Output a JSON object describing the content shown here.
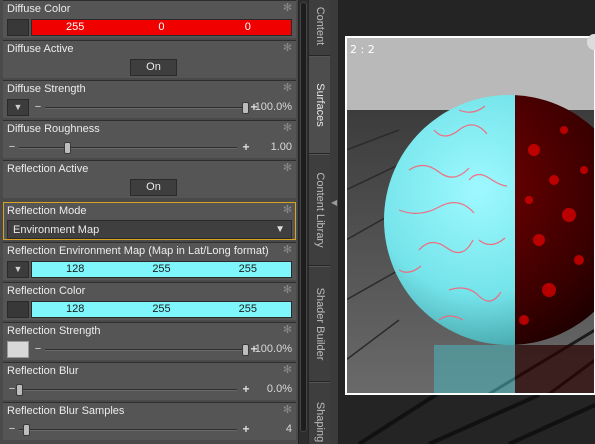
{
  "properties": {
    "diffuse_color": {
      "label": "Diffuse Color",
      "r": "255",
      "g": "0",
      "b": "0"
    },
    "diffuse_active": {
      "label": "Diffuse Active",
      "value": "On"
    },
    "diffuse_strength": {
      "label": "Diffuse Strength",
      "value": "100.0%",
      "level": 1.0
    },
    "diffuse_roughness": {
      "label": "Diffuse Roughness",
      "value": "1.00",
      "level": 0.22
    },
    "reflection_active": {
      "label": "Reflection Active",
      "value": "On"
    },
    "reflection_mode": {
      "label": "Reflection Mode",
      "value": "Environment Map"
    },
    "reflection_env_map": {
      "label": "Reflection Environment Map (Map in Lat/Long format)",
      "r": "128",
      "g": "255",
      "b": "255"
    },
    "reflection_color": {
      "label": "Reflection Color",
      "r": "128",
      "g": "255",
      "b": "255"
    },
    "reflection_strength": {
      "label": "Reflection Strength",
      "value": "100.0%",
      "level": 1.0
    },
    "reflection_blur": {
      "label": "Reflection Blur",
      "value": "0.0%",
      "level": 0.0
    },
    "reflection_blur_samples": {
      "label": "Reflection Blur Samples",
      "value": "4",
      "level": 0.03
    }
  },
  "tabs": [
    "Content",
    "Surfaces",
    "Content Library",
    "Shader Builder",
    "Shaping"
  ],
  "active_tab": "Surfaces",
  "viewport": {
    "label": "2 : 2"
  },
  "colors": {
    "diffuse": "#f10000",
    "reflection": "#7ff6fb",
    "selected_outline": "#d9a520"
  }
}
